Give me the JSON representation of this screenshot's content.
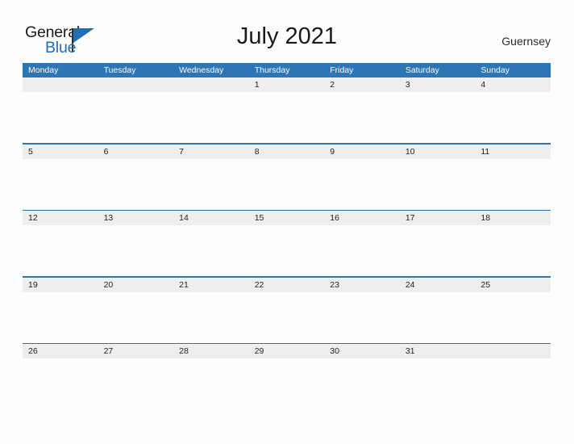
{
  "brand": {
    "word_one": "General",
    "word_two": "Blue",
    "triangle_icon": "triangle-right-icon",
    "accent_color": "#1f6fb8"
  },
  "header": {
    "title": "July 2021",
    "locale": "Guernsey"
  },
  "calendar": {
    "header_color": "#2e75b6",
    "date_band_color": "#eeeeee",
    "day_names": [
      "Monday",
      "Tuesday",
      "Wednesday",
      "Thursday",
      "Friday",
      "Saturday",
      "Sunday"
    ],
    "weeks": [
      [
        "",
        "",
        "",
        "1",
        "2",
        "3",
        "4"
      ],
      [
        "5",
        "6",
        "7",
        "8",
        "9",
        "10",
        "11"
      ],
      [
        "12",
        "13",
        "14",
        "15",
        "16",
        "17",
        "18"
      ],
      [
        "19",
        "20",
        "21",
        "22",
        "23",
        "24",
        "25"
      ],
      [
        "26",
        "27",
        "28",
        "29",
        "30",
        "31",
        ""
      ]
    ]
  }
}
